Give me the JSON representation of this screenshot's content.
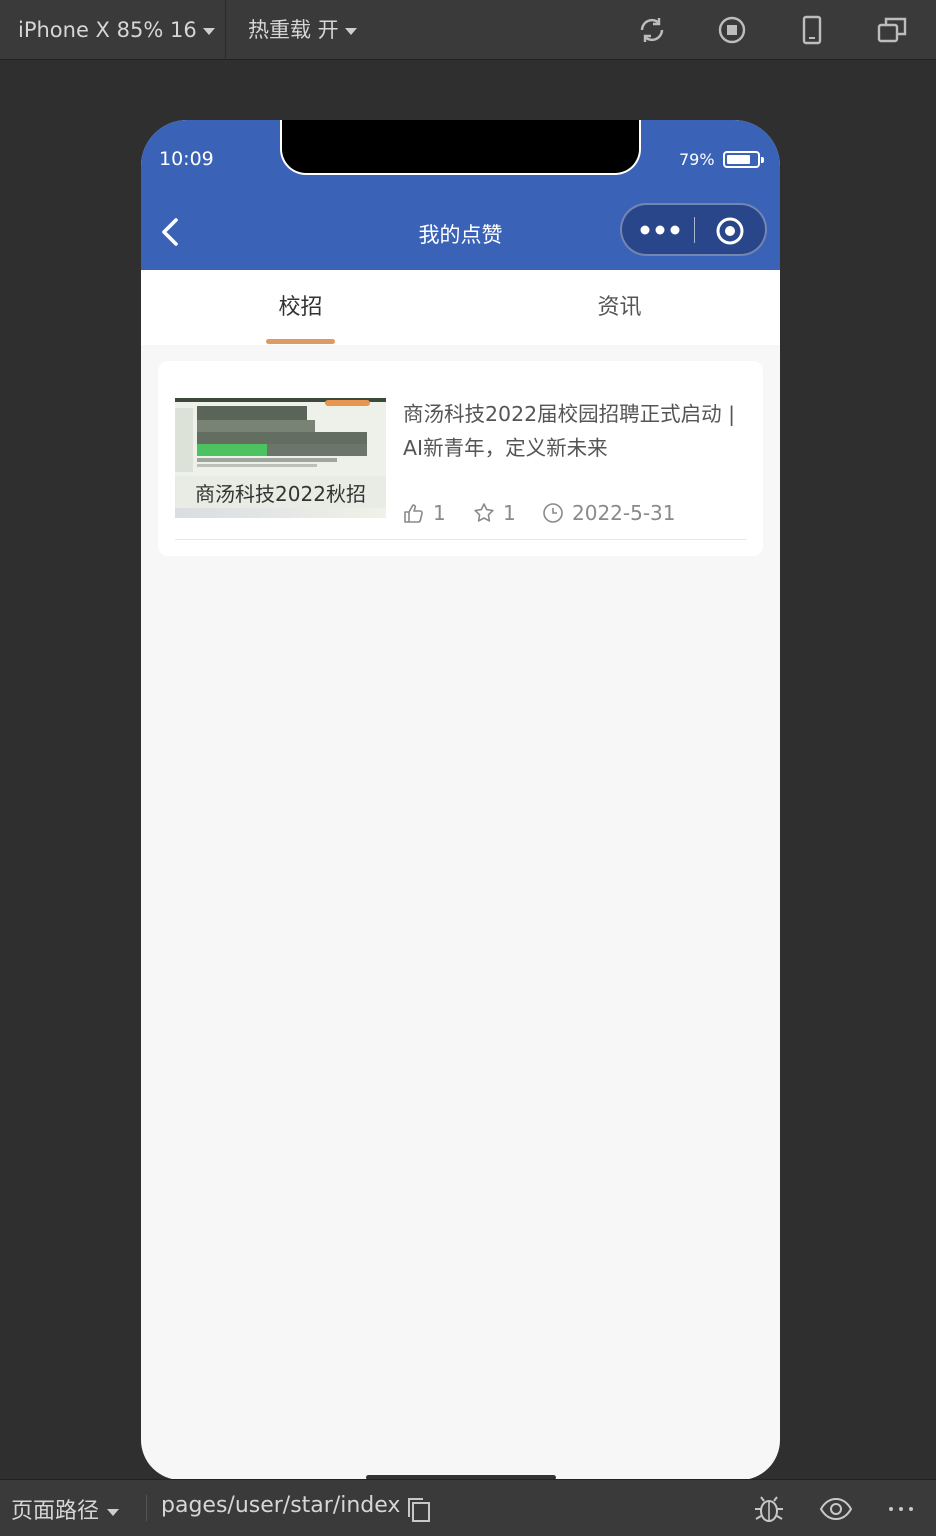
{
  "toolbar": {
    "device": "iPhone X 85% 16",
    "hot_reload": "热重载 开"
  },
  "status": {
    "time": "10:09",
    "battery": "79%",
    "battery_level": 0.79
  },
  "nav": {
    "title": "我的点赞"
  },
  "tabs": [
    {
      "label": "校招",
      "active": true
    },
    {
      "label": "资讯",
      "active": false
    }
  ],
  "card": {
    "thumb_caption": "商汤科技2022秋招",
    "title": "商汤科技2022届校园招聘正式启动 | AI新青年，定义新未来",
    "likes": "1",
    "stars": "1",
    "date": "2022-5-31"
  },
  "bottom": {
    "path_label": "页面路径",
    "path_value": "pages/user/star/index"
  },
  "colors": {
    "brand": "#3a63b8",
    "tab_indicator": "#dd9a63"
  }
}
